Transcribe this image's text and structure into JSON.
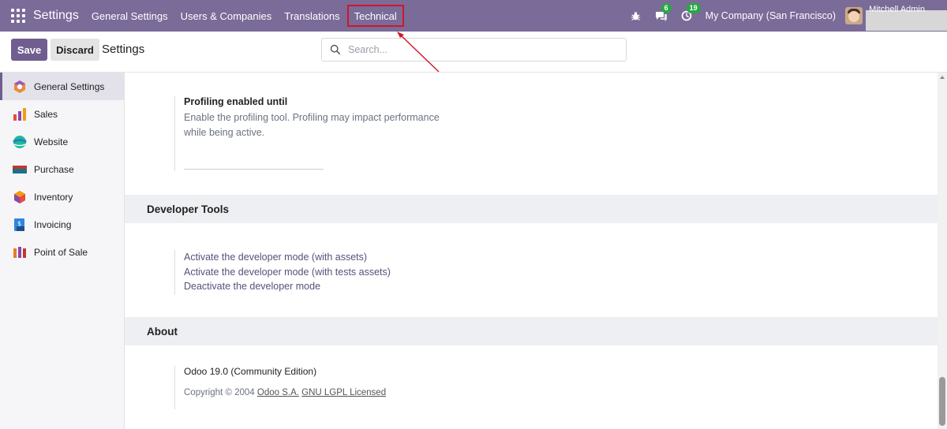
{
  "navbar": {
    "brand": "Settings",
    "menus": [
      "General Settings",
      "Users & Companies",
      "Translations",
      "Technical"
    ],
    "messages_badge": "6",
    "activity_badge": "19",
    "company": "My Company (San Francisco)",
    "user": "Mitchell Admin"
  },
  "control": {
    "save_label": "Save",
    "discard_label": "Discard",
    "title": "Settings",
    "search_placeholder": "Search..."
  },
  "sidebar": {
    "items": [
      {
        "label": "General Settings",
        "icon": "settings-app-icon"
      },
      {
        "label": "Sales",
        "icon": "sales-app-icon"
      },
      {
        "label": "Website",
        "icon": "website-app-icon"
      },
      {
        "label": "Purchase",
        "icon": "purchase-app-icon"
      },
      {
        "label": "Inventory",
        "icon": "inventory-app-icon"
      },
      {
        "label": "Invoicing",
        "icon": "invoicing-app-icon"
      },
      {
        "label": "Point of Sale",
        "icon": "pos-app-icon"
      }
    ]
  },
  "main": {
    "profiling": {
      "title": "Profiling enabled until",
      "desc_line1": "Enable the profiling tool. Profiling may impact performance",
      "desc_line2": "while being active."
    },
    "developer_tools": {
      "heading": "Developer Tools",
      "links": [
        "Activate the developer mode (with assets)",
        "Activate the developer mode (with tests assets)",
        "Deactivate the developer mode"
      ]
    },
    "about": {
      "heading": "About",
      "version": "Odoo 19.0 (Community Edition)",
      "copyright_prefix": "Copyright © 2004",
      "company_link": "Odoo S.A.",
      "license_link": "GNU LGPL Licensed"
    }
  },
  "colors": {
    "navbar": "#7a6b98",
    "primary_button": "#6f5e8f",
    "highlight_box": "#d0162a",
    "badge": "#28a745"
  }
}
